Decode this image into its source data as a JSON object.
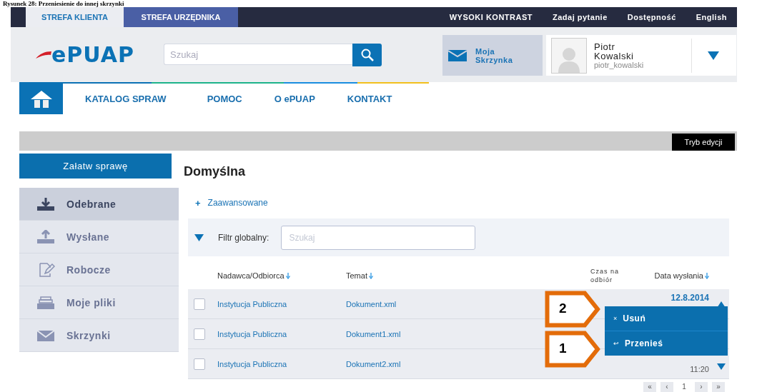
{
  "caption": "Rysunek 28: Przeniesienie do innej skrzynki",
  "top_bar": {
    "tabs": [
      {
        "label": "STREFA KLIENTA",
        "selected": true
      },
      {
        "label": "STREFA URZĘDNIKA",
        "selected": false
      }
    ],
    "links": [
      "WYSOKI KONTRAST",
      "Zadaj pytanie",
      "Dostępność",
      "English"
    ]
  },
  "header": {
    "logo": "ePUAP",
    "search": {
      "placeholder": "Szukaj"
    },
    "mailbox": "Moja Skrzynka",
    "user": {
      "name": "Piotr Kowalski",
      "login": "piotr_kowalski"
    }
  },
  "nav": {
    "items": [
      "KATALOG SPRAW",
      "POMOC",
      "O ePUAP",
      "KONTAKT"
    ]
  },
  "edit_bar": {
    "button": "Tryb edycji"
  },
  "sidebar": {
    "action": "Załatw sprawę",
    "items": [
      {
        "label": "Odebrane",
        "selected": true
      },
      {
        "label": "Wysłane",
        "selected": false
      },
      {
        "label": "Robocze",
        "selected": false
      },
      {
        "label": "Moje pliki",
        "selected": false
      },
      {
        "label": "Skrzynki",
        "selected": false
      }
    ]
  },
  "main": {
    "title": "Domyślna",
    "advanced": {
      "icon": "+",
      "label": "Zaawansowane"
    },
    "filter": {
      "label": "Filtr globalny:",
      "placeholder": "Szukaj"
    },
    "table": {
      "columns": [
        {
          "label": "Nadawca/Odbiorca",
          "sortable": true
        },
        {
          "label": "Temat",
          "sortable": true
        },
        {
          "label": "Czas na odbiór",
          "sortable": false
        },
        {
          "label": "Data wysłania",
          "sortable": true
        }
      ],
      "rows": [
        {
          "checked": false,
          "sender": "Instytucja Publiczna",
          "subject": "Dokument.xml",
          "date": "12.8.2014",
          "expanded": true
        },
        {
          "checked": false,
          "sender": "Instytucja Publiczna",
          "subject": "Dokument1.xml"
        },
        {
          "checked": false,
          "sender": "Instytucja Publiczna",
          "subject": "Dokument2.xml",
          "time": "11:20",
          "expanded": false
        }
      ]
    },
    "row_menu": [
      {
        "icon": "×",
        "label": "Usuń"
      },
      {
        "icon": "↩",
        "label": "Przenieś"
      }
    ],
    "callouts": [
      "2",
      "1"
    ],
    "pagination": [
      "«",
      "‹",
      "1",
      "›",
      "»"
    ]
  }
}
